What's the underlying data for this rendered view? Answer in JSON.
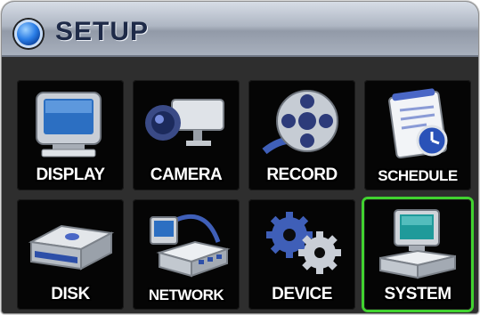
{
  "window": {
    "title": "SETUP"
  },
  "menu": {
    "selected": "SYSTEM",
    "items": [
      {
        "label": "DISPLAY",
        "icon": "monitor-icon"
      },
      {
        "label": "CAMERA",
        "icon": "camera-icon"
      },
      {
        "label": "RECORD",
        "icon": "film-reel-icon"
      },
      {
        "label": "SCHEDULE",
        "icon": "schedule-icon"
      },
      {
        "label": "DISK",
        "icon": "disk-drive-icon"
      },
      {
        "label": "NETWORK",
        "icon": "network-icon"
      },
      {
        "label": "DEVICE",
        "icon": "gears-icon"
      },
      {
        "label": "SYSTEM",
        "icon": "computer-icon"
      }
    ]
  },
  "colors": {
    "selection": "#41d230",
    "title_text": "#1e2a48"
  }
}
